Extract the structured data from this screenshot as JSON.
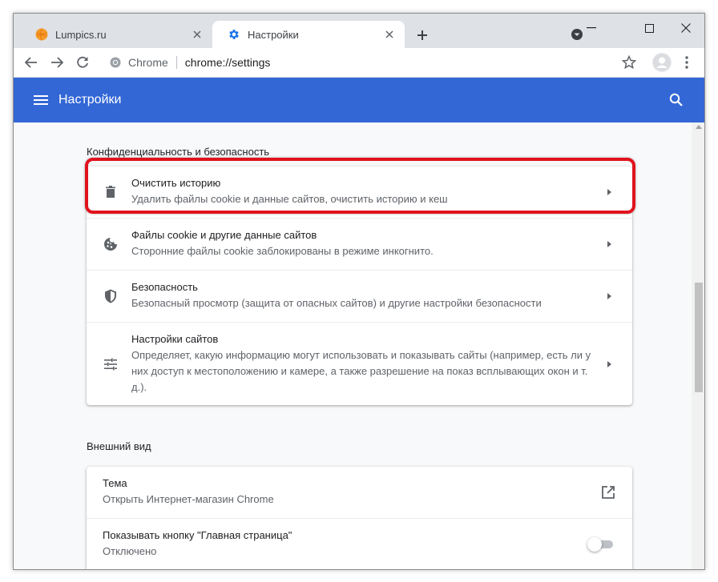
{
  "tabs": [
    {
      "title": "Lumpics.ru",
      "favicon": "orange-ball-favicon",
      "active": false
    },
    {
      "title": "Настройки",
      "favicon": "gear-icon",
      "active": true
    }
  ],
  "toolbar": {
    "omnibox_chip": "Chrome",
    "omnibox_url": "chrome://settings"
  },
  "header": {
    "title": "Настройки"
  },
  "privacy": {
    "section_title": "Конфиденциальность и безопасность",
    "rows": [
      {
        "icon": "trash-icon",
        "label": "Очистить историю",
        "sub": "Удалить файлы cookie и данные сайтов, очистить историю и кеш"
      },
      {
        "icon": "cookie-icon",
        "label": "Файлы cookie и другие данные сайтов",
        "sub": "Сторонние файлы cookie заблокированы в режиме инкогнито."
      },
      {
        "icon": "shield-icon",
        "label": "Безопасность",
        "sub": "Безопасный просмотр (защита от опасных сайтов) и другие настройки безопасности"
      },
      {
        "icon": "tune-icon",
        "label": "Настройки сайтов",
        "sub": "Определяет, какую информацию могут использовать и показывать сайты (например, есть ли у них доступ к местоположению и камере, а также разрешение на показ всплывающих окон и т. д.)."
      }
    ]
  },
  "appearance": {
    "section_title": "Внешний вид",
    "rows": [
      {
        "label": "Тема",
        "sub": "Открыть Интернет-магазин Chrome"
      },
      {
        "label": "Показывать кнопку \"Главная страница\"",
        "sub": "Отключено",
        "toggle": false
      }
    ]
  },
  "colors": {
    "accent": "#3367d6",
    "highlight": "#e0131d"
  }
}
